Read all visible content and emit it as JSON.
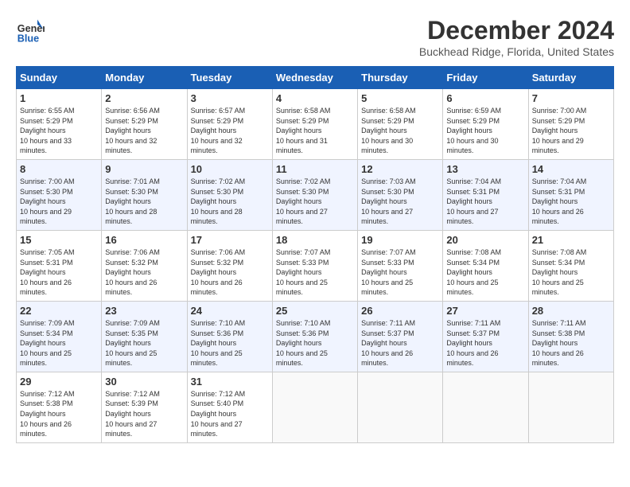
{
  "header": {
    "logo_line1": "General",
    "logo_line2": "Blue",
    "month_title": "December 2024",
    "location": "Buckhead Ridge, Florida, United States"
  },
  "weekdays": [
    "Sunday",
    "Monday",
    "Tuesday",
    "Wednesday",
    "Thursday",
    "Friday",
    "Saturday"
  ],
  "weeks": [
    [
      {
        "day": "1",
        "sunrise": "6:55 AM",
        "sunset": "5:29 PM",
        "daylight": "10 hours and 33 minutes."
      },
      {
        "day": "2",
        "sunrise": "6:56 AM",
        "sunset": "5:29 PM",
        "daylight": "10 hours and 32 minutes."
      },
      {
        "day": "3",
        "sunrise": "6:57 AM",
        "sunset": "5:29 PM",
        "daylight": "10 hours and 32 minutes."
      },
      {
        "day": "4",
        "sunrise": "6:58 AM",
        "sunset": "5:29 PM",
        "daylight": "10 hours and 31 minutes."
      },
      {
        "day": "5",
        "sunrise": "6:58 AM",
        "sunset": "5:29 PM",
        "daylight": "10 hours and 30 minutes."
      },
      {
        "day": "6",
        "sunrise": "6:59 AM",
        "sunset": "5:29 PM",
        "daylight": "10 hours and 30 minutes."
      },
      {
        "day": "7",
        "sunrise": "7:00 AM",
        "sunset": "5:29 PM",
        "daylight": "10 hours and 29 minutes."
      }
    ],
    [
      {
        "day": "8",
        "sunrise": "7:00 AM",
        "sunset": "5:30 PM",
        "daylight": "10 hours and 29 minutes."
      },
      {
        "day": "9",
        "sunrise": "7:01 AM",
        "sunset": "5:30 PM",
        "daylight": "10 hours and 28 minutes."
      },
      {
        "day": "10",
        "sunrise": "7:02 AM",
        "sunset": "5:30 PM",
        "daylight": "10 hours and 28 minutes."
      },
      {
        "day": "11",
        "sunrise": "7:02 AM",
        "sunset": "5:30 PM",
        "daylight": "10 hours and 27 minutes."
      },
      {
        "day": "12",
        "sunrise": "7:03 AM",
        "sunset": "5:30 PM",
        "daylight": "10 hours and 27 minutes."
      },
      {
        "day": "13",
        "sunrise": "7:04 AM",
        "sunset": "5:31 PM",
        "daylight": "10 hours and 27 minutes."
      },
      {
        "day": "14",
        "sunrise": "7:04 AM",
        "sunset": "5:31 PM",
        "daylight": "10 hours and 26 minutes."
      }
    ],
    [
      {
        "day": "15",
        "sunrise": "7:05 AM",
        "sunset": "5:31 PM",
        "daylight": "10 hours and 26 minutes."
      },
      {
        "day": "16",
        "sunrise": "7:06 AM",
        "sunset": "5:32 PM",
        "daylight": "10 hours and 26 minutes."
      },
      {
        "day": "17",
        "sunrise": "7:06 AM",
        "sunset": "5:32 PM",
        "daylight": "10 hours and 26 minutes."
      },
      {
        "day": "18",
        "sunrise": "7:07 AM",
        "sunset": "5:33 PM",
        "daylight": "10 hours and 25 minutes."
      },
      {
        "day": "19",
        "sunrise": "7:07 AM",
        "sunset": "5:33 PM",
        "daylight": "10 hours and 25 minutes."
      },
      {
        "day": "20",
        "sunrise": "7:08 AM",
        "sunset": "5:34 PM",
        "daylight": "10 hours and 25 minutes."
      },
      {
        "day": "21",
        "sunrise": "7:08 AM",
        "sunset": "5:34 PM",
        "daylight": "10 hours and 25 minutes."
      }
    ],
    [
      {
        "day": "22",
        "sunrise": "7:09 AM",
        "sunset": "5:34 PM",
        "daylight": "10 hours and 25 minutes."
      },
      {
        "day": "23",
        "sunrise": "7:09 AM",
        "sunset": "5:35 PM",
        "daylight": "10 hours and 25 minutes."
      },
      {
        "day": "24",
        "sunrise": "7:10 AM",
        "sunset": "5:36 PM",
        "daylight": "10 hours and 25 minutes."
      },
      {
        "day": "25",
        "sunrise": "7:10 AM",
        "sunset": "5:36 PM",
        "daylight": "10 hours and 25 minutes."
      },
      {
        "day": "26",
        "sunrise": "7:11 AM",
        "sunset": "5:37 PM",
        "daylight": "10 hours and 26 minutes."
      },
      {
        "day": "27",
        "sunrise": "7:11 AM",
        "sunset": "5:37 PM",
        "daylight": "10 hours and 26 minutes."
      },
      {
        "day": "28",
        "sunrise": "7:11 AM",
        "sunset": "5:38 PM",
        "daylight": "10 hours and 26 minutes."
      }
    ],
    [
      {
        "day": "29",
        "sunrise": "7:12 AM",
        "sunset": "5:38 PM",
        "daylight": "10 hours and 26 minutes."
      },
      {
        "day": "30",
        "sunrise": "7:12 AM",
        "sunset": "5:39 PM",
        "daylight": "10 hours and 27 minutes."
      },
      {
        "day": "31",
        "sunrise": "7:12 AM",
        "sunset": "5:40 PM",
        "daylight": "10 hours and 27 minutes."
      },
      null,
      null,
      null,
      null
    ]
  ]
}
